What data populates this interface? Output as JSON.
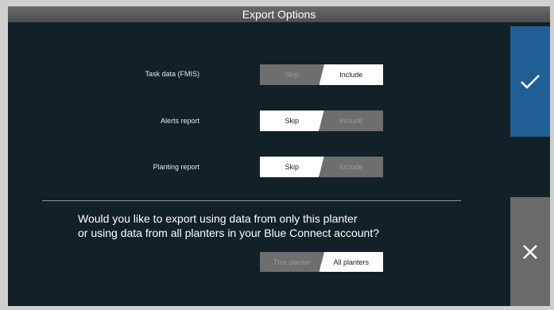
{
  "window": {
    "title": "Export Options"
  },
  "options": [
    {
      "label": "Task data (FMIS)",
      "left": "Skip",
      "right": "Include",
      "selected": "Include"
    },
    {
      "label": "Alerts report",
      "left": "Skip",
      "right": "Include",
      "selected": "Skip"
    },
    {
      "label": "Planting report",
      "left": "Skip",
      "right": "Include",
      "selected": "Skip"
    }
  ],
  "question": {
    "line1": "Would you like to export using data from only this planter",
    "line2": "or using data from all planters in your Blue Connect account?"
  },
  "scope": {
    "left": "This planter",
    "right": "All planters",
    "selected": "All planters"
  },
  "actions": {
    "confirm_icon": "check-icon",
    "cancel_icon": "close-icon"
  },
  "colors": {
    "background": "#122027",
    "confirm": "#1f5f95",
    "cancel": "#6a6a6a",
    "selected": "#ffffff",
    "unselected": "#6e6e6e"
  }
}
